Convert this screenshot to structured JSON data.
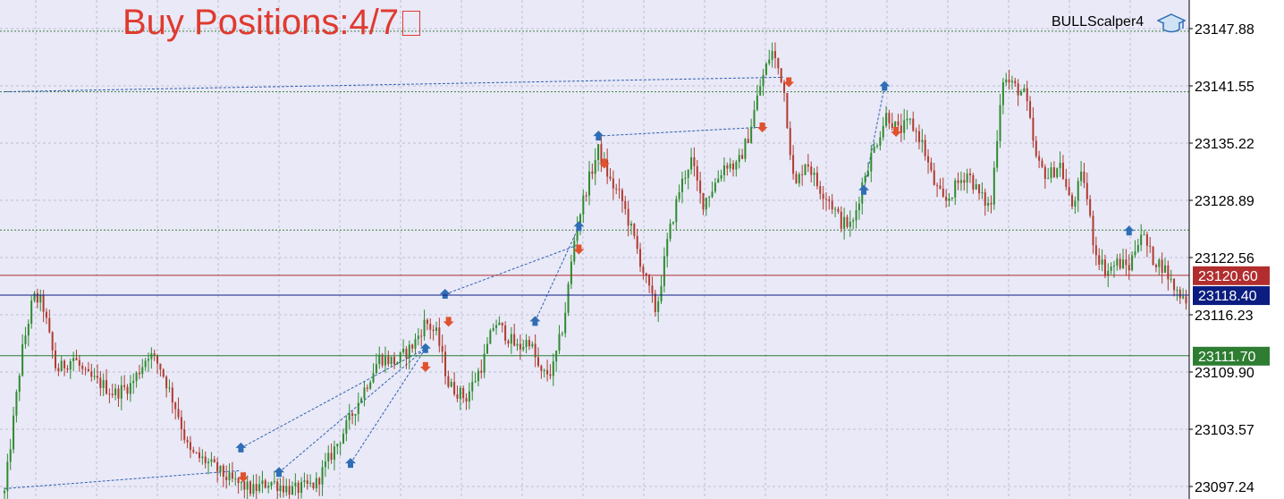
{
  "chart_title": "Buy Positions:4/7",
  "expert_name": "BULLScalper4",
  "icons": {
    "expert": "graduation-cap-icon",
    "buy": "up-arrow-icon",
    "sell": "down-arrow-icon"
  },
  "colors": {
    "background": "#e9e9f7",
    "grid": "#bfbfd6",
    "bull_candle": "#2e8b2e",
    "bear_candle": "#b03a2e",
    "buy_arrow": "#2f6eb5",
    "sell_arrow": "#e0522e",
    "red_line": "#c62828",
    "blue_line": "#0b1d80",
    "green_line": "#2e7d32",
    "title": "#e03a2f"
  },
  "price_axis": {
    "ticks": [
      "23147.88",
      "23141.55",
      "23135.22",
      "23128.89",
      "23122.56",
      "23116.23",
      "23109.90",
      "23103.57",
      "23097.24"
    ]
  },
  "levels": [
    {
      "name": "red-level",
      "price": "23120.60",
      "color": "#b22e2e"
    },
    {
      "name": "blue-level",
      "price": "23118.40",
      "color": "#0b1d80"
    },
    {
      "name": "green-level",
      "price": "23111.70",
      "color": "#2e7d32"
    }
  ],
  "chart_data": {
    "type": "candlestick",
    "y_ticks": [
      23147.88,
      23141.55,
      23135.22,
      23128.89,
      23122.56,
      23116.23,
      23109.9,
      23103.57,
      23097.24
    ],
    "ylim": [
      23096.5,
      23149.5
    ],
    "dashed_levels": [
      23147.6,
      23140.9,
      23125.6
    ],
    "close_path": [
      [
        0.0,
        23096.5
      ],
      [
        1.5,
        23112.0
      ],
      [
        2.5,
        23118.2
      ],
      [
        3.3,
        23117.5
      ],
      [
        4.5,
        23110.0
      ],
      [
        6.0,
        23111.5
      ],
      [
        7.0,
        23109.5
      ],
      [
        8.5,
        23108.5
      ],
      [
        9.5,
        23107.5
      ],
      [
        11.0,
        23108.5
      ],
      [
        12.5,
        23112.0
      ],
      [
        13.5,
        23110.5
      ],
      [
        15.0,
        23105.5
      ],
      [
        16.0,
        23101.0
      ],
      [
        17.5,
        23100.0
      ],
      [
        19.5,
        23098.0
      ],
      [
        21.5,
        23096.8
      ],
      [
        23.0,
        23097.8
      ],
      [
        25.0,
        23096.8
      ],
      [
        27.0,
        23097.5
      ],
      [
        28.0,
        23100.0
      ],
      [
        29.5,
        23103.5
      ],
      [
        31.0,
        23107.5
      ],
      [
        32.5,
        23111.5
      ],
      [
        34.0,
        23111.0
      ],
      [
        35.5,
        23113.0
      ],
      [
        36.5,
        23115.5
      ],
      [
        37.5,
        23114.0
      ],
      [
        38.5,
        23108.5
      ],
      [
        40.0,
        23107.0
      ],
      [
        41.5,
        23111.0
      ],
      [
        42.5,
        23115.5
      ],
      [
        43.5,
        23114.0
      ],
      [
        44.5,
        23112.5
      ],
      [
        45.5,
        23113.5
      ],
      [
        46.5,
        23109.5
      ],
      [
        47.5,
        23110.0
      ],
      [
        48.5,
        23115.5
      ],
      [
        49.5,
        23125.5
      ],
      [
        50.5,
        23130.5
      ],
      [
        51.5,
        23134.5
      ],
      [
        52.5,
        23131.0
      ],
      [
        53.5,
        23129.0
      ],
      [
        54.5,
        23125.0
      ],
      [
        55.5,
        23120.5
      ],
      [
        56.5,
        23116.5
      ],
      [
        57.5,
        23124.5
      ],
      [
        58.5,
        23130.0
      ],
      [
        59.5,
        23133.5
      ],
      [
        60.5,
        23128.5
      ],
      [
        61.5,
        23130.5
      ],
      [
        62.5,
        23133.0
      ],
      [
        63.5,
        23132.5
      ],
      [
        64.5,
        23136.0
      ],
      [
        65.5,
        23141.5
      ],
      [
        66.5,
        23145.5
      ],
      [
        67.5,
        23142.0
      ],
      [
        68.5,
        23130.0
      ],
      [
        69.5,
        23133.5
      ],
      [
        70.5,
        23130.5
      ],
      [
        71.5,
        23129.0
      ],
      [
        72.5,
        23126.5
      ],
      [
        73.5,
        23126.0
      ],
      [
        74.5,
        23131.5
      ],
      [
        75.5,
        23135.0
      ],
      [
        76.5,
        23138.5
      ],
      [
        77.5,
        23136.5
      ],
      [
        78.5,
        23137.5
      ],
      [
        79.5,
        23135.5
      ],
      [
        80.5,
        23131.0
      ],
      [
        81.5,
        23128.5
      ],
      [
        82.5,
        23130.5
      ],
      [
        83.5,
        23132.0
      ],
      [
        84.5,
        23129.5
      ],
      [
        85.5,
        23128.0
      ],
      [
        86.5,
        23142.5
      ],
      [
        87.5,
        23141.5
      ],
      [
        88.5,
        23140.5
      ],
      [
        89.5,
        23133.0
      ],
      [
        90.5,
        23131.5
      ],
      [
        91.5,
        23133.0
      ],
      [
        92.5,
        23128.0
      ],
      [
        93.5,
        23132.0
      ],
      [
        94.5,
        23123.5
      ],
      [
        95.5,
        23121.0
      ],
      [
        96.5,
        23122.0
      ],
      [
        97.5,
        23121.5
      ],
      [
        98.5,
        23125.5
      ],
      [
        99.5,
        23122.5
      ],
      [
        100.5,
        23121.5
      ],
      [
        101.5,
        23119.0
      ],
      [
        102.5,
        23118.0
      ],
      [
        103.0,
        23117.5
      ]
    ],
    "buy_arrows": [
      [
        20.5,
        23101.5
      ],
      [
        23.8,
        23098.8
      ],
      [
        30.0,
        23099.8
      ],
      [
        36.5,
        23112.5
      ],
      [
        38.2,
        23118.5
      ],
      [
        46.0,
        23115.5
      ],
      [
        49.8,
        23126.0
      ],
      [
        51.5,
        23136.0
      ],
      [
        74.5,
        23130.0
      ],
      [
        76.3,
        23141.5
      ],
      [
        97.5,
        23125.5
      ]
    ],
    "sell_arrows": [
      [
        20.7,
        23098.3
      ],
      [
        24.0,
        23095.3
      ],
      [
        36.5,
        23110.5
      ],
      [
        38.5,
        23115.5
      ],
      [
        49.8,
        23123.5
      ],
      [
        52.0,
        23133.0
      ],
      [
        65.7,
        23137.0
      ],
      [
        68.0,
        23142.0
      ],
      [
        77.3,
        23136.5
      ]
    ],
    "dashed_links": [
      [
        0,
        23140.9,
        67.5,
        23142.5
      ],
      [
        0,
        23097.0,
        20.5,
        23099.0
      ],
      [
        20.5,
        23101.5,
        36.5,
        23112.5
      ],
      [
        23.8,
        23098.8,
        36.5,
        23112.5
      ],
      [
        30.0,
        23099.8,
        36.5,
        23112.5
      ],
      [
        38.2,
        23118.5,
        49.8,
        23124.0
      ],
      [
        46.0,
        23115.5,
        49.8,
        23126.0
      ],
      [
        51.5,
        23136.0,
        66.0,
        23137.0
      ],
      [
        74.5,
        23130.0,
        76.3,
        23141.5
      ]
    ]
  }
}
